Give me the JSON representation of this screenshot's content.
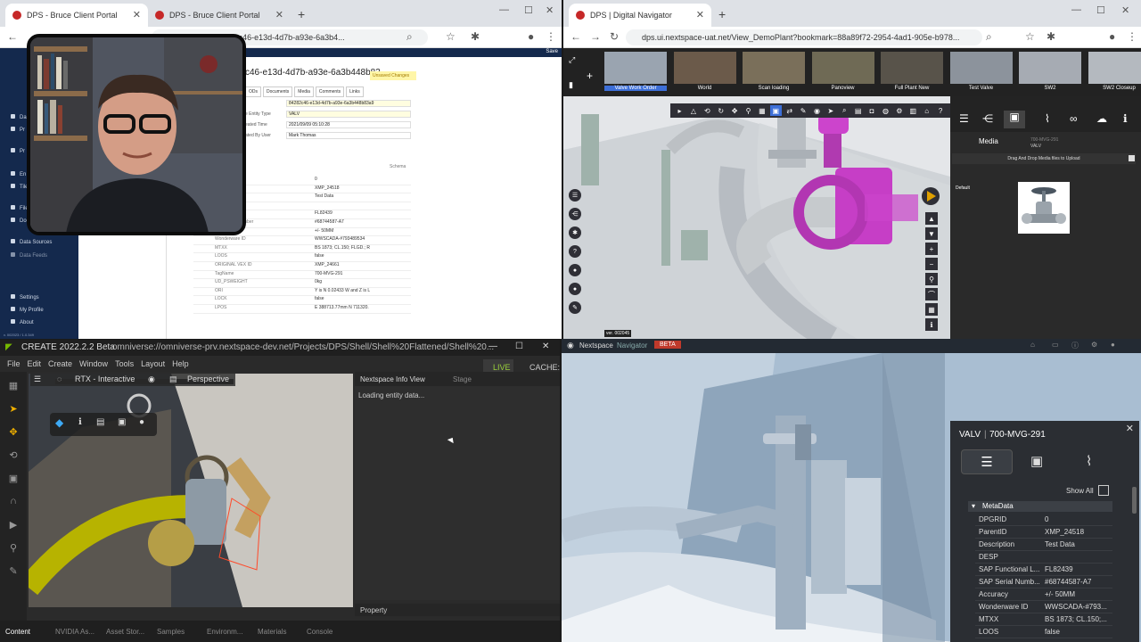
{
  "q1": {
    "tabs": [
      {
        "label": "DPS - Bruce Client Portal"
      },
      {
        "label": "DPS - Bruce Client Portal"
      }
    ],
    "url": "...deEntities2/84282c46-e13d-4d7b-a93e-6a3b4...",
    "header_save": "Save",
    "entity_title": "c46-e13d-4d7b-a93e-6a3b448b83",
    "unsaved": "Unsaved Changes",
    "entity_tabs": [
      "ODs",
      "Documents",
      "Media",
      "Comments",
      "Links"
    ],
    "fields": [
      {
        "label": "e Entity Type",
        "value": "VALV"
      },
      {
        "label": "eated Time",
        "value": "2021/09/09 05:10:28"
      },
      {
        "label": "ated By User",
        "value": "Mark Thomas"
      }
    ],
    "entity_id_value": "84282c46-e13d-4d7b-a93e-6a3b448b83a9",
    "schema_label": "Schema",
    "sidebar": [
      "Da",
      "Pr",
      "Pr",
      "En",
      "Tile",
      "File",
      "Doc",
      "Data Sources",
      "Data Feeds",
      "Settings",
      "My Profile",
      "About"
    ],
    "version": "v. 002023 / 1.0.349",
    "meta_rows": [
      {
        "k": "",
        "v": "0"
      },
      {
        "k": "",
        "v": "XMP_24518"
      },
      {
        "k": "",
        "v": "Test Data"
      },
      {
        "k": "",
        "v": ""
      },
      {
        "k": "onal Location",
        "v": "FL82439"
      },
      {
        "k": "SAP Serial Number",
        "v": "#68744587-A7"
      },
      {
        "k": "Accuracy",
        "v": "+/- 50MM"
      },
      {
        "k": "Wonderware ID",
        "v": "WWSCADA-#793489534"
      },
      {
        "k": "MTXX",
        "v": "BS 1873; CL.150; FLGD.; R"
      },
      {
        "k": "LOOS",
        "v": "false"
      },
      {
        "k": "ORIGINAL VEX ID",
        "v": "XMP_24661"
      },
      {
        "k": "TagName",
        "v": "700-MVG-291"
      },
      {
        "k": "UD_PSWEIGHT",
        "v": "0kg"
      },
      {
        "k": "ORI",
        "v": "Y is N 0.02433 W and Z is L"
      },
      {
        "k": "LOCK",
        "v": "false"
      },
      {
        "k": "LPOS",
        "v": "E 388713.77mm N 711320."
      }
    ]
  },
  "q2": {
    "tab": "DPS | Digital Navigator",
    "url": "dps.ui.nextspace-uat.net/View_DemoPlant?bookmark=88a89f72-2954-4ad1-905e-b978...",
    "bookmarks": [
      "Valve Work Order",
      "World",
      "Scan loading",
      "Panoview",
      "Full Plant New",
      "Test Valve",
      "SW2",
      "SW2 Closeup"
    ],
    "media_title": "Media",
    "media_entity_id": "700-MVG-291",
    "media_entity_type": "VALV",
    "drop_hint": "Drag And Drop Media files to Upload",
    "group_label": "Default",
    "version": "ver. 002045"
  },
  "q3": {
    "app_title": "CREATE  2022.2.2  Beta",
    "path": "omniverse://omniverse-prv.nextspace-dev.net/Projects/DPS/Shell/Shell%20Flattened/Shell%20...",
    "menu": [
      "File",
      "Edit",
      "Create",
      "Window",
      "Tools",
      "Layout",
      "Help"
    ],
    "live": "LIVE",
    "cache": "CACHE: ON",
    "render_mode": "RTX - Interactive",
    "camera": "Perspective",
    "panel_tabs": [
      "Nextspace Info View",
      "Stage"
    ],
    "loading_text": "Loading entity data...",
    "property_label": "Property",
    "bottom_tabs": [
      "Content",
      "NVIDIA As...",
      "Asset Stor...",
      "Samples",
      "Environm...",
      "Materials",
      "Console"
    ]
  },
  "q4": {
    "brand": "Nextspace",
    "brand_sub": "Navigator",
    "beta": "BETA",
    "card_type": "VALV",
    "card_title": "700-MVG-291",
    "show_all": "Show All",
    "section": "MetaData",
    "rows": [
      {
        "k": "DPGRID",
        "v": "0"
      },
      {
        "k": "ParentID",
        "v": "XMP_24518"
      },
      {
        "k": "Description",
        "v": "Test Data"
      },
      {
        "k": "DESP",
        "v": ""
      },
      {
        "k": "SAP Functional L...",
        "v": "FL82439"
      },
      {
        "k": "SAP Serial Numb...",
        "v": "#68744587-A7"
      },
      {
        "k": "Accuracy",
        "v": "+/- 50MM"
      },
      {
        "k": "Wonderware ID",
        "v": "WWSCADA-#793..."
      },
      {
        "k": "MTXX",
        "v": "BS 1873; CL.150;..."
      },
      {
        "k": "LOOS",
        "v": "false"
      }
    ]
  }
}
